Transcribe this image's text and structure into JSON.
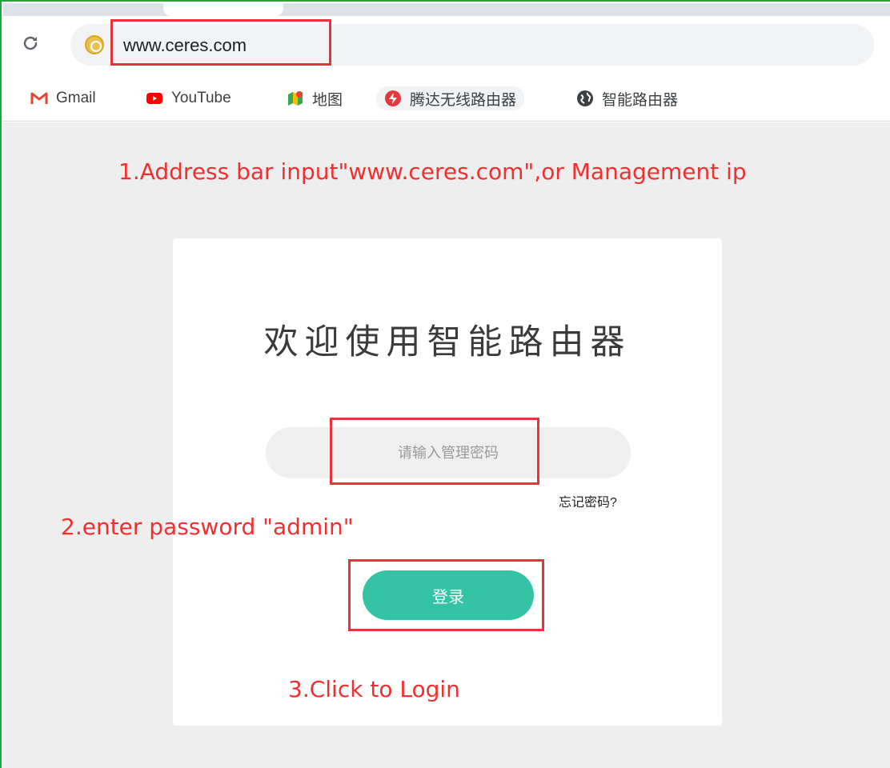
{
  "browser": {
    "url": "www.ceres.com",
    "bookmarks": [
      {
        "label": "Gmail",
        "icon": "gmail-icon"
      },
      {
        "label": "YouTube",
        "icon": "youtube-icon"
      },
      {
        "label": "地图",
        "icon": "maps-icon"
      },
      {
        "label": "腾达无线路由器",
        "icon": "tenda-icon"
      },
      {
        "label": "智能路由器",
        "icon": "globe-icon"
      }
    ]
  },
  "login": {
    "title": "欢迎使用智能路由器",
    "password_placeholder": "请输入管理密码",
    "forgot_label": "忘记密码?",
    "login_button": "登录"
  },
  "annotations": {
    "step1": "1.Address bar input\"www.ceres.com\",or Management ip",
    "step2": "2.enter password \"admin\"",
    "step3": "3.Click to Login"
  },
  "colors": {
    "annotation_red": "#e8333a",
    "login_green": "#34c3a4",
    "page_bg": "#eeeeee"
  }
}
